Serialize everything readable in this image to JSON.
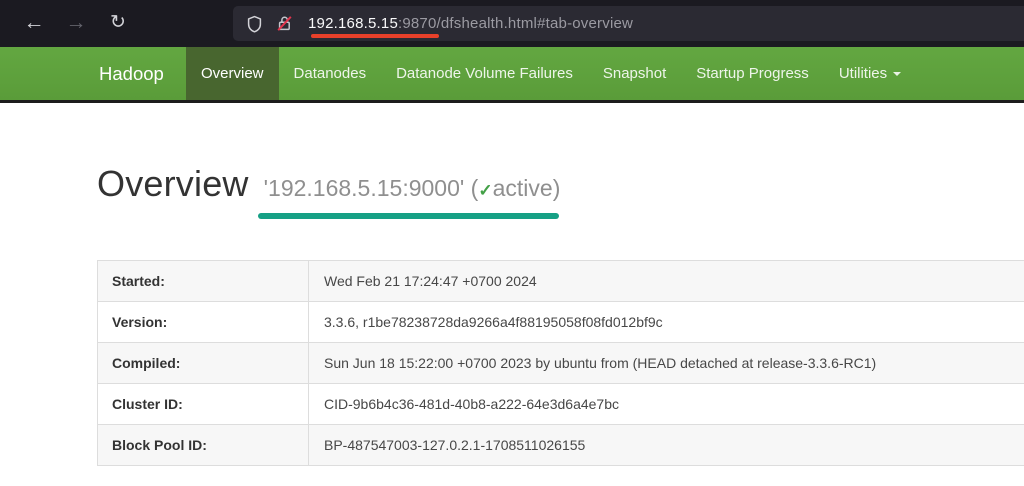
{
  "browser": {
    "back_icon": "←",
    "forward_icon": "→",
    "reload_icon": "↻",
    "url": {
      "host": "192.168.5.15",
      "rest": ":9870/dfshealth.html#tab-overview"
    }
  },
  "navbar": {
    "brand": "Hadoop",
    "items": [
      {
        "label": "Overview",
        "active": true
      },
      {
        "label": "Datanodes",
        "active": false
      },
      {
        "label": "Datanode Volume Failures",
        "active": false
      },
      {
        "label": "Snapshot",
        "active": false
      },
      {
        "label": "Startup Progress",
        "active": false
      },
      {
        "label": "Utilities",
        "active": false,
        "has_dropdown": true
      }
    ]
  },
  "main": {
    "title": "Overview",
    "address": "'192.168.5.15:9000'",
    "paren_open": "(",
    "check": "✓",
    "status": "active",
    "paren_close": ")"
  },
  "table": {
    "rows": [
      {
        "label": "Started:",
        "value": "Wed Feb 21 17:24:47 +0700 2024"
      },
      {
        "label": "Version:",
        "value": "3.3.6, r1be78238728da9266a4f88195058f08fd012bf9c"
      },
      {
        "label": "Compiled:",
        "value": "Sun Jun 18 15:22:00 +0700 2023 by ubuntu from (HEAD detached at release-3.3.6-RC1)"
      },
      {
        "label": "Cluster ID:",
        "value": "CID-9b6b4c36-481d-40b8-a222-64e3d6a4e7bc"
      },
      {
        "label": "Block Pool ID:",
        "value": "BP-487547003-127.0.2.1-1708511026155"
      }
    ]
  },
  "annotations": {
    "url_underline_color": "#e8402a",
    "address_underline_color": "#16a085"
  },
  "colors": {
    "chrome_dark": "#1b1a21",
    "urlbar_dark": "#2b2a33",
    "navbar_green": "#5f9e3c",
    "active_tab_green": "#48662f"
  }
}
